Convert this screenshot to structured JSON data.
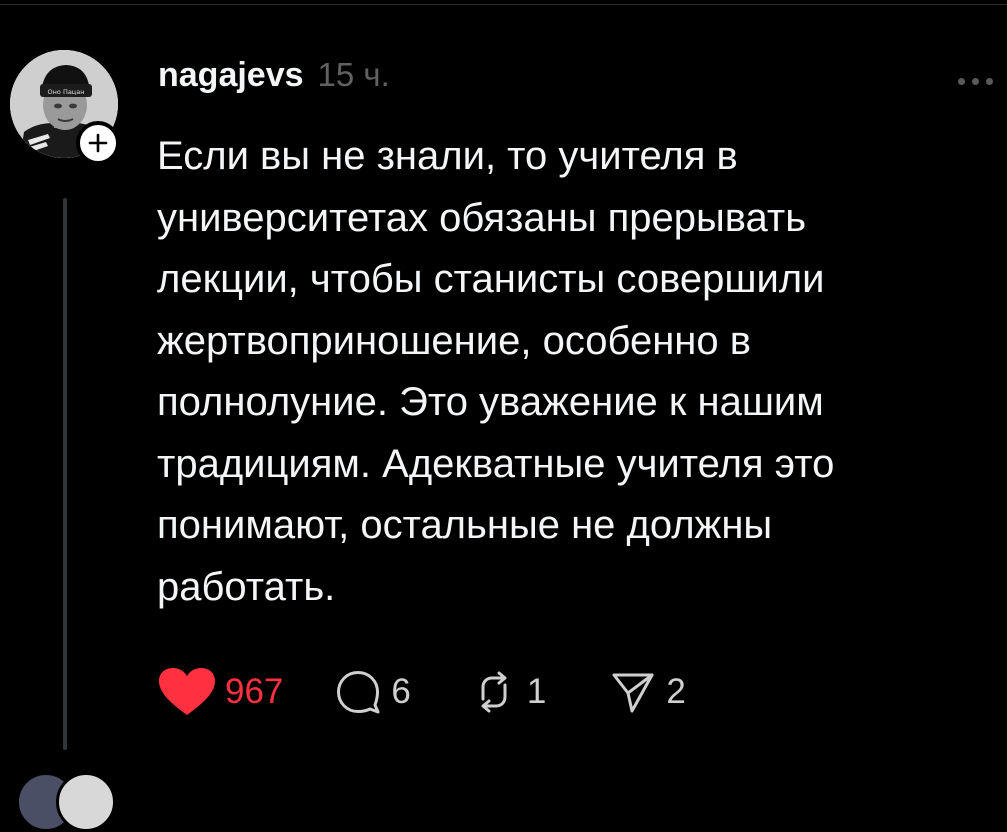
{
  "post": {
    "username": "nagajevs",
    "timestamp": "15 ч.",
    "text": "Если вы не знали, то учителя в\nуниверситетах обязаны прерывать\nлекции, чтобы станисты совершили\nжертвоприношение, особенно в\nполнолуние. Это уважение к нашим\nтрадициям. Адекватные учителя это\nпонимают, остальные не должны\nработать.",
    "avatar_cap_text": "Оно Пацан"
  },
  "actions": {
    "likes": "967",
    "replies": "6",
    "reposts": "1",
    "shares": "2"
  },
  "icons": {
    "like": "heart-icon",
    "reply": "comment-bubble-icon",
    "repost": "repost-icon",
    "share": "send-icon",
    "follow": "plus-icon",
    "more": "ellipsis-icon"
  },
  "colors": {
    "background": "#000000",
    "text": "#f3f5f7",
    "muted": "#616161",
    "like_red": "#ff3040",
    "thread_line": "#333638"
  }
}
